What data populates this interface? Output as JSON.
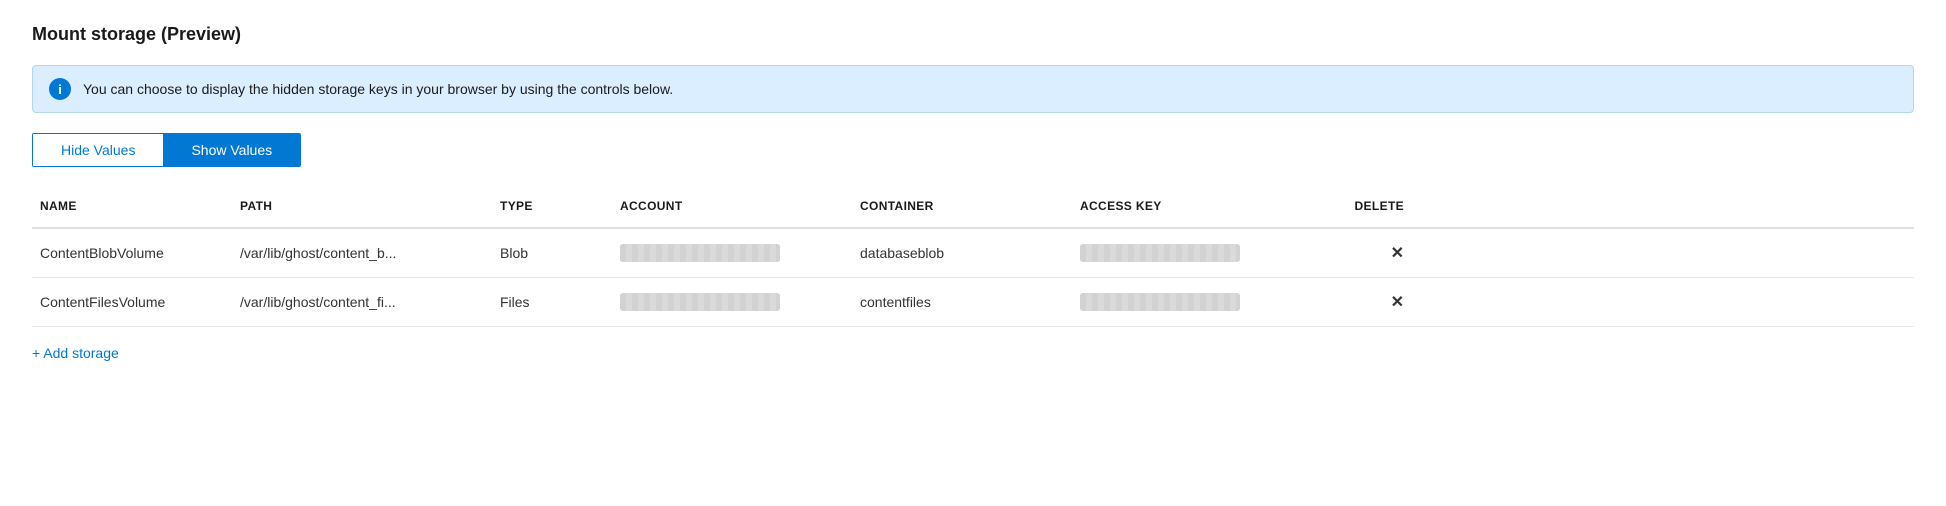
{
  "page": {
    "title": "Mount storage (Preview)"
  },
  "info_banner": {
    "text": "You can choose to display the hidden storage keys in your browser by using the controls below."
  },
  "toggle": {
    "hide_label": "Hide Values",
    "show_label": "Show Values"
  },
  "table": {
    "columns": [
      "NAME",
      "PATH",
      "TYPE",
      "ACCOUNT",
      "CONTAINER",
      "ACCESS KEY",
      "DELETE"
    ],
    "rows": [
      {
        "name": "ContentBlobVolume",
        "path": "/var/lib/ghost/content_b...",
        "type": "Blob",
        "account": "masked",
        "container": "databaseblob",
        "access_key": "masked",
        "delete": "✕"
      },
      {
        "name": "ContentFilesVolume",
        "path": "/var/lib/ghost/content_fi...",
        "type": "Files",
        "account": "masked",
        "container": "contentfiles",
        "access_key": "masked",
        "delete": "✕"
      }
    ]
  },
  "add_storage": {
    "label": "+ Add storage"
  }
}
